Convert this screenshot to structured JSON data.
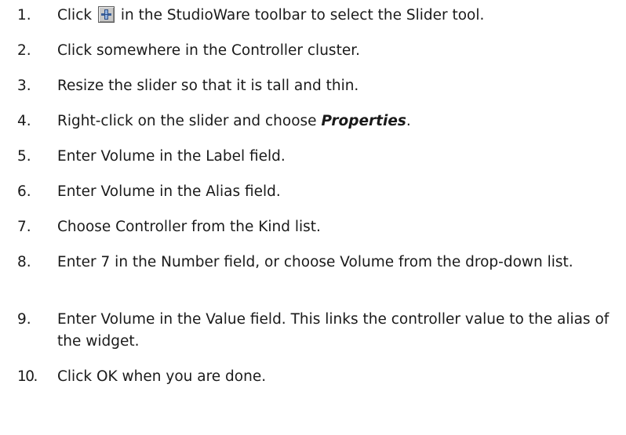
{
  "steps": [
    {
      "number": "1.",
      "text_before": "Click",
      "icon": "slider-tool-icon",
      "text_after": "in the StudioWare toolbar to select the Slider tool."
    },
    {
      "number": "2.",
      "text": "Click somewhere in the Controller cluster."
    },
    {
      "number": "3.",
      "text": "Resize the slider so that it is tall and thin."
    },
    {
      "number": "4.",
      "text_before": "Right-click on the slider and choose",
      "emphasis": "Properties",
      "text_after": "."
    },
    {
      "number": "5.",
      "text": "Enter Volume in the Label field."
    },
    {
      "number": "6.",
      "text": "Enter Volume in the Alias field."
    },
    {
      "number": "7.",
      "text": "Choose Controller from the Kind list."
    },
    {
      "number": "8.",
      "text": "Enter 7 in the Number field, or choose Volume from the drop-down list."
    },
    {
      "number": "9.",
      "text": "Enter Volume in the Value field. This links the controller value to the alias of the widget."
    },
    {
      "number": "10.",
      "text": "Click OK when you are done."
    }
  ]
}
